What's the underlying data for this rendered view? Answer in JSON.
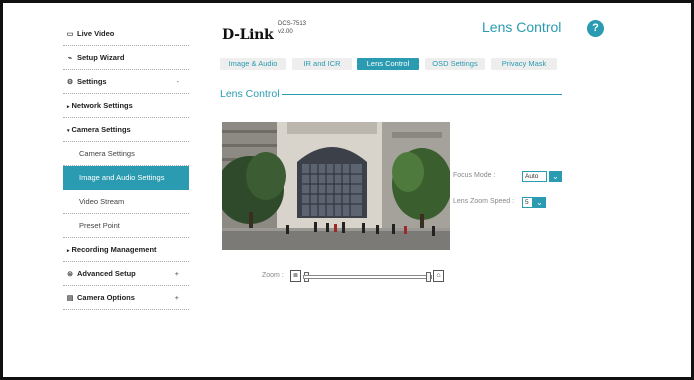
{
  "sidebar": {
    "live_video": "Live Video",
    "setup_wizard": "Setup Wizard",
    "settings": "Settings",
    "settings_toggle": "-",
    "network_settings": "Network Settings",
    "camera_settings": "Camera Settings",
    "camera_settings_leaf": "Camera Settings",
    "image_audio_settings": "Image and Audio Settings",
    "video_stream": "Video Stream",
    "preset_point": "Preset Point",
    "recording_management": "Recording Management",
    "advanced_setup": "Advanced Setup",
    "advanced_toggle": "+",
    "camera_options": "Camera Options",
    "camera_options_toggle": "+"
  },
  "header": {
    "logo": "D-Link",
    "model": "DCS-7513",
    "version": "v2.00",
    "page_title": "Lens Control",
    "help": "?"
  },
  "tabs": [
    {
      "label": "Image & Audio"
    },
    {
      "label": "IR and ICR"
    },
    {
      "label": "Lens Control"
    },
    {
      "label": "OSD Settings"
    },
    {
      "label": "Privacy Mask"
    }
  ],
  "section_title": "Lens Control",
  "controls": {
    "focus_mode_label": "Focus Mode :",
    "focus_mode_value": "Auto",
    "zoom_speed_label": "Lens Zoom Speed :",
    "zoom_speed_value": "5"
  },
  "zoom": {
    "label": "Zoom :"
  },
  "colors": {
    "accent": "#2a9bb0",
    "frame": "#111111"
  }
}
